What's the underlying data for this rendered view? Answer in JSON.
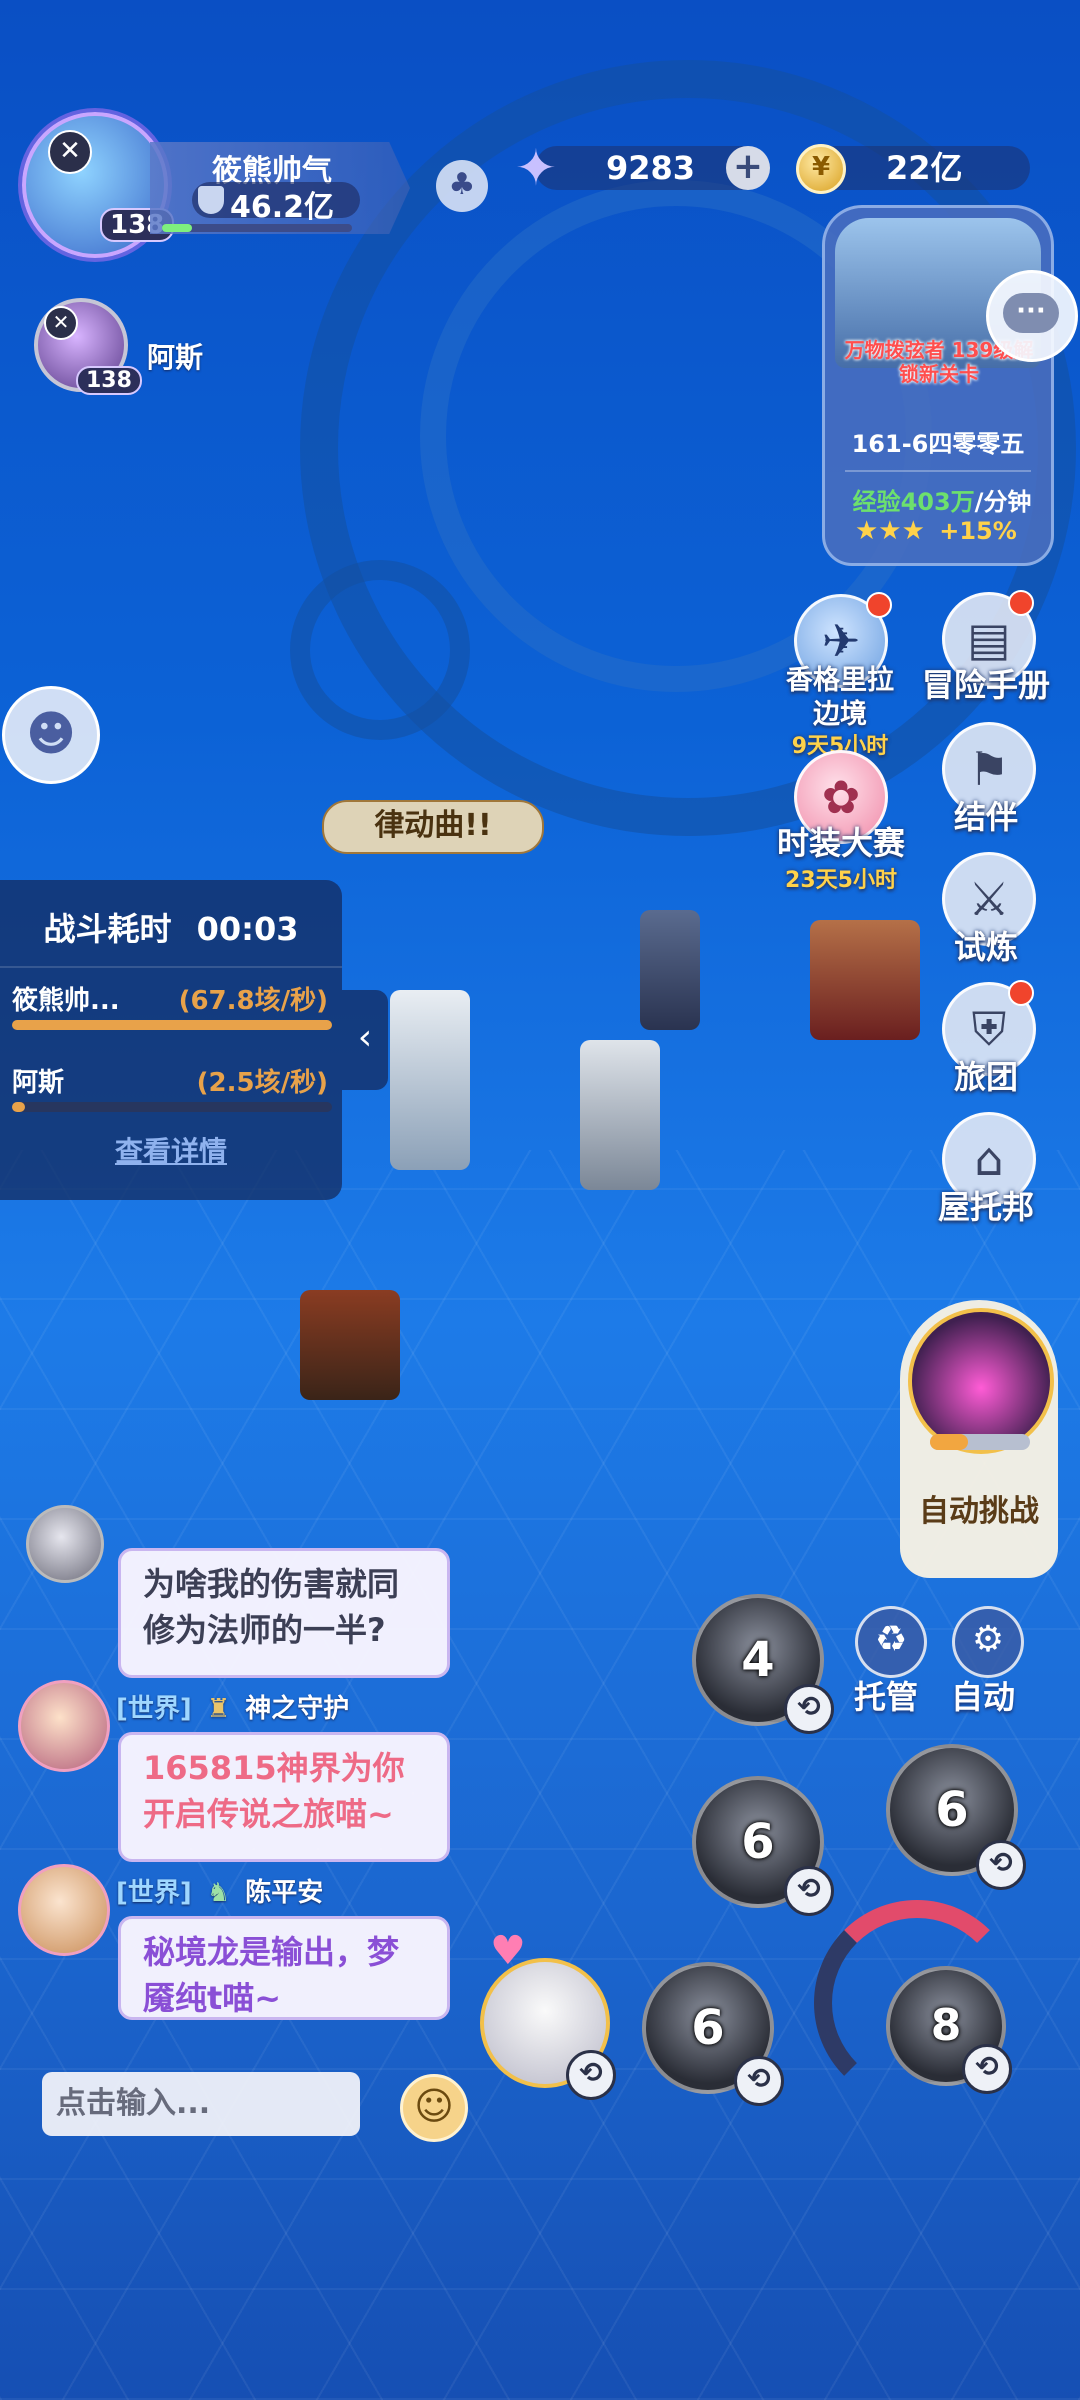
{
  "player": {
    "name": "筱熊帅气",
    "power": "46.2亿",
    "level": "138"
  },
  "currency": {
    "stars": "9283",
    "gold": "22亿"
  },
  "teammate": {
    "name": "阿斯",
    "level": "138"
  },
  "stage_card": {
    "notice": "万物拨弦者 139级解锁新关卡",
    "stage": "161-6四零零五",
    "exp_label": "经验",
    "exp_value": "403万",
    "exp_unit": "/分钟",
    "bonus": "+15%"
  },
  "events": [
    {
      "title": "香格里拉",
      "title2": "边境",
      "timer": "9天5小时"
    },
    {
      "title": "时装大赛",
      "timer": "23天5小时"
    }
  ],
  "menu": [
    "冒险手册",
    "结伴",
    "试炼",
    "旅团",
    "屋托邦"
  ],
  "scene": {
    "floating_label": "律动曲!!"
  },
  "battle": {
    "title": "战斗耗时",
    "time": "00:03",
    "rows": [
      {
        "name": "筱熊帅...",
        "dps": "(67.8垓/秒)",
        "fill": 1.0
      },
      {
        "name": "阿斯",
        "dps": "(2.5垓/秒)",
        "fill": 0.04
      }
    ],
    "details_link": "查看详情"
  },
  "chat": [
    {
      "channel": "",
      "name": "",
      "message": "为啥我的伤害就同修为法师的一半?",
      "color": "#3c3f55"
    },
    {
      "channel": "[世界]",
      "name": "神之守护",
      "message": "165815神界为你开启传说之旅喵~",
      "color": "#ee6a86"
    },
    {
      "channel": "[世界]",
      "name": "陈平安",
      "message": "秘境龙是输出，梦魇纯t喵~",
      "color": "#8a4fd6"
    }
  ],
  "chat_input": {
    "placeholder": "点击输入..."
  },
  "controls": {
    "auto_challenge": "自动挑战",
    "hosting": "托管",
    "auto": "自动"
  },
  "skills": [
    {
      "cooldown": "4"
    },
    {
      "cooldown": "6"
    },
    {
      "cooldown": "6"
    },
    {
      "cooldown": "6"
    },
    {
      "cooldown": "8"
    }
  ],
  "colors": {
    "accent_orange": "#e8a24a",
    "event_timer": "#ffd24a",
    "exp_green": "#6de06d"
  }
}
